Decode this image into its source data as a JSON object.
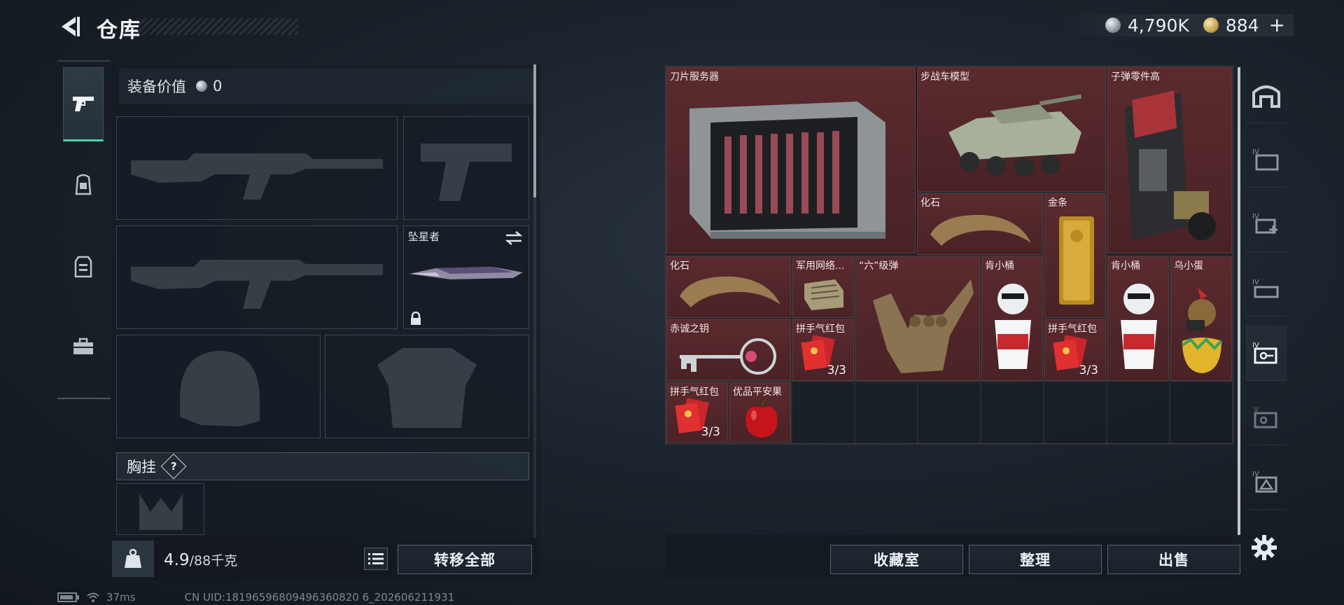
{
  "header": {
    "title": "仓库",
    "currency_silver": "4,790K",
    "currency_gold": "884",
    "plus_label": "+"
  },
  "loadout": {
    "equip_value_label": "装备价值",
    "equip_value": "0",
    "melee_name": "坠星者",
    "chest_label": "胸挂",
    "help_label": "?",
    "weight_current": "4.9",
    "weight_max": "/88千克",
    "transfer_all": "转移全部"
  },
  "storage": {
    "items": [
      {
        "name": "刀片服务器"
      },
      {
        "name": "步战车模型"
      },
      {
        "name": "子弹零件高"
      },
      {
        "name": "化石"
      },
      {
        "name": "金条"
      },
      {
        "name": "化石"
      },
      {
        "name": "军用网络..."
      },
      {
        "name": "“六”级弹"
      },
      {
        "name": "肯小桶"
      },
      {
        "name": "肯小桶"
      },
      {
        "name": "乌小蛋"
      },
      {
        "name": "赤诚之钥"
      },
      {
        "name": "拼手气红包",
        "count": "3/3"
      },
      {
        "name": "拼手气红包",
        "count": "3/3"
      },
      {
        "name": "拼手气红包",
        "count": "3/3"
      },
      {
        "name": "优品平安果"
      }
    ]
  },
  "actions": {
    "collection": "收藏室",
    "organize": "整理",
    "sell": "出售"
  },
  "status": {
    "ping": "37ms",
    "uid": "CN UID:18196596809496360820 6_202606211931"
  },
  "colors": {
    "accent": "#4fd1a8",
    "item_bg": "#5a2a2e",
    "background": "#1b232c"
  },
  "icons": [
    "back-arrow-icon",
    "pistol-icon",
    "backpack-icon",
    "vest-icon",
    "briefcase-icon",
    "silver-coin-icon",
    "gold-coin-icon",
    "lock-icon",
    "swap-icon",
    "list-icon",
    "wifi-icon",
    "battery-icon",
    "settings-icon"
  ]
}
